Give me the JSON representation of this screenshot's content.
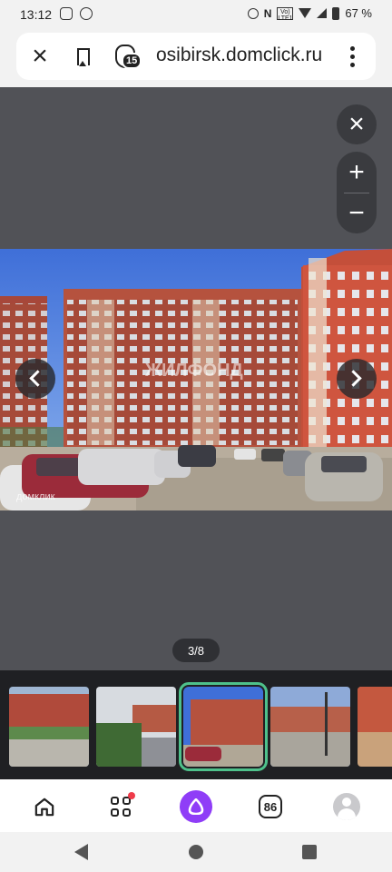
{
  "status_bar": {
    "time": "13:12",
    "battery": "67 %",
    "network": "Vo) LTE1",
    "icons": [
      "instagram-icon",
      "vk-icon",
      "alarm-icon",
      "nfc-icon",
      "wifi-icon",
      "signal-icon",
      "battery-icon"
    ]
  },
  "browser": {
    "url": "osibirsk.domclick.ru",
    "shield_count": "15",
    "icons": [
      "close-icon",
      "bookmark-icon",
      "shield-icon",
      "more-icon"
    ]
  },
  "gallery": {
    "counter": "3/8",
    "current": 3,
    "total": 8,
    "watermark": "ЖИЛФОНД",
    "corner_mark": "домклик",
    "close_label": "×",
    "zoom_in_label": "+",
    "zoom_out_label": "−"
  },
  "bottom_nav": {
    "tabs_count": "86",
    "items": [
      "home-icon",
      "apps-icon",
      "alice-icon",
      "tabs-icon",
      "profile-icon"
    ]
  }
}
